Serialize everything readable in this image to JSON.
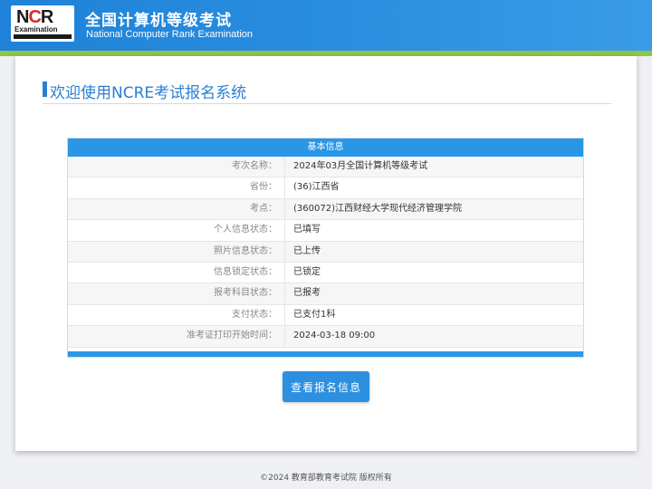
{
  "header": {
    "logo_top": "N",
    "logo_c": "C",
    "logo_r": "R",
    "logo_sub": "Examination",
    "title_cn": "全国计算机等级考试",
    "title_en": "National Computer Rank Examination"
  },
  "welcome": "欢迎使用NCRE考试报名系统",
  "info": {
    "heading": "基本信息",
    "rows": [
      {
        "label": "考次名称：",
        "value": "2024年03月全国计算机等级考试"
      },
      {
        "label": "省份：",
        "value": "(36)江西省"
      },
      {
        "label": "考点：",
        "value": "(360072)江西财经大学现代经济管理学院"
      },
      {
        "label": "个人信息状态：",
        "value": "已填写"
      },
      {
        "label": "照片信息状态：",
        "value": "已上传"
      },
      {
        "label": "信息锁定状态：",
        "value": "已锁定"
      },
      {
        "label": "报考科目状态：",
        "value": "已报考"
      },
      {
        "label": "支付状态：",
        "value": "已支付1科"
      },
      {
        "label": "准考证打印开始时间：",
        "value": "2024-03-18 09:00"
      }
    ]
  },
  "view_button": "查看报名信息",
  "footer": "©2024 教育部教育考试院 版权所有",
  "colors": {
    "header_blue": "#1e82d8",
    "accent_green": "#8fc44a",
    "table_blue": "#2a96e6"
  }
}
